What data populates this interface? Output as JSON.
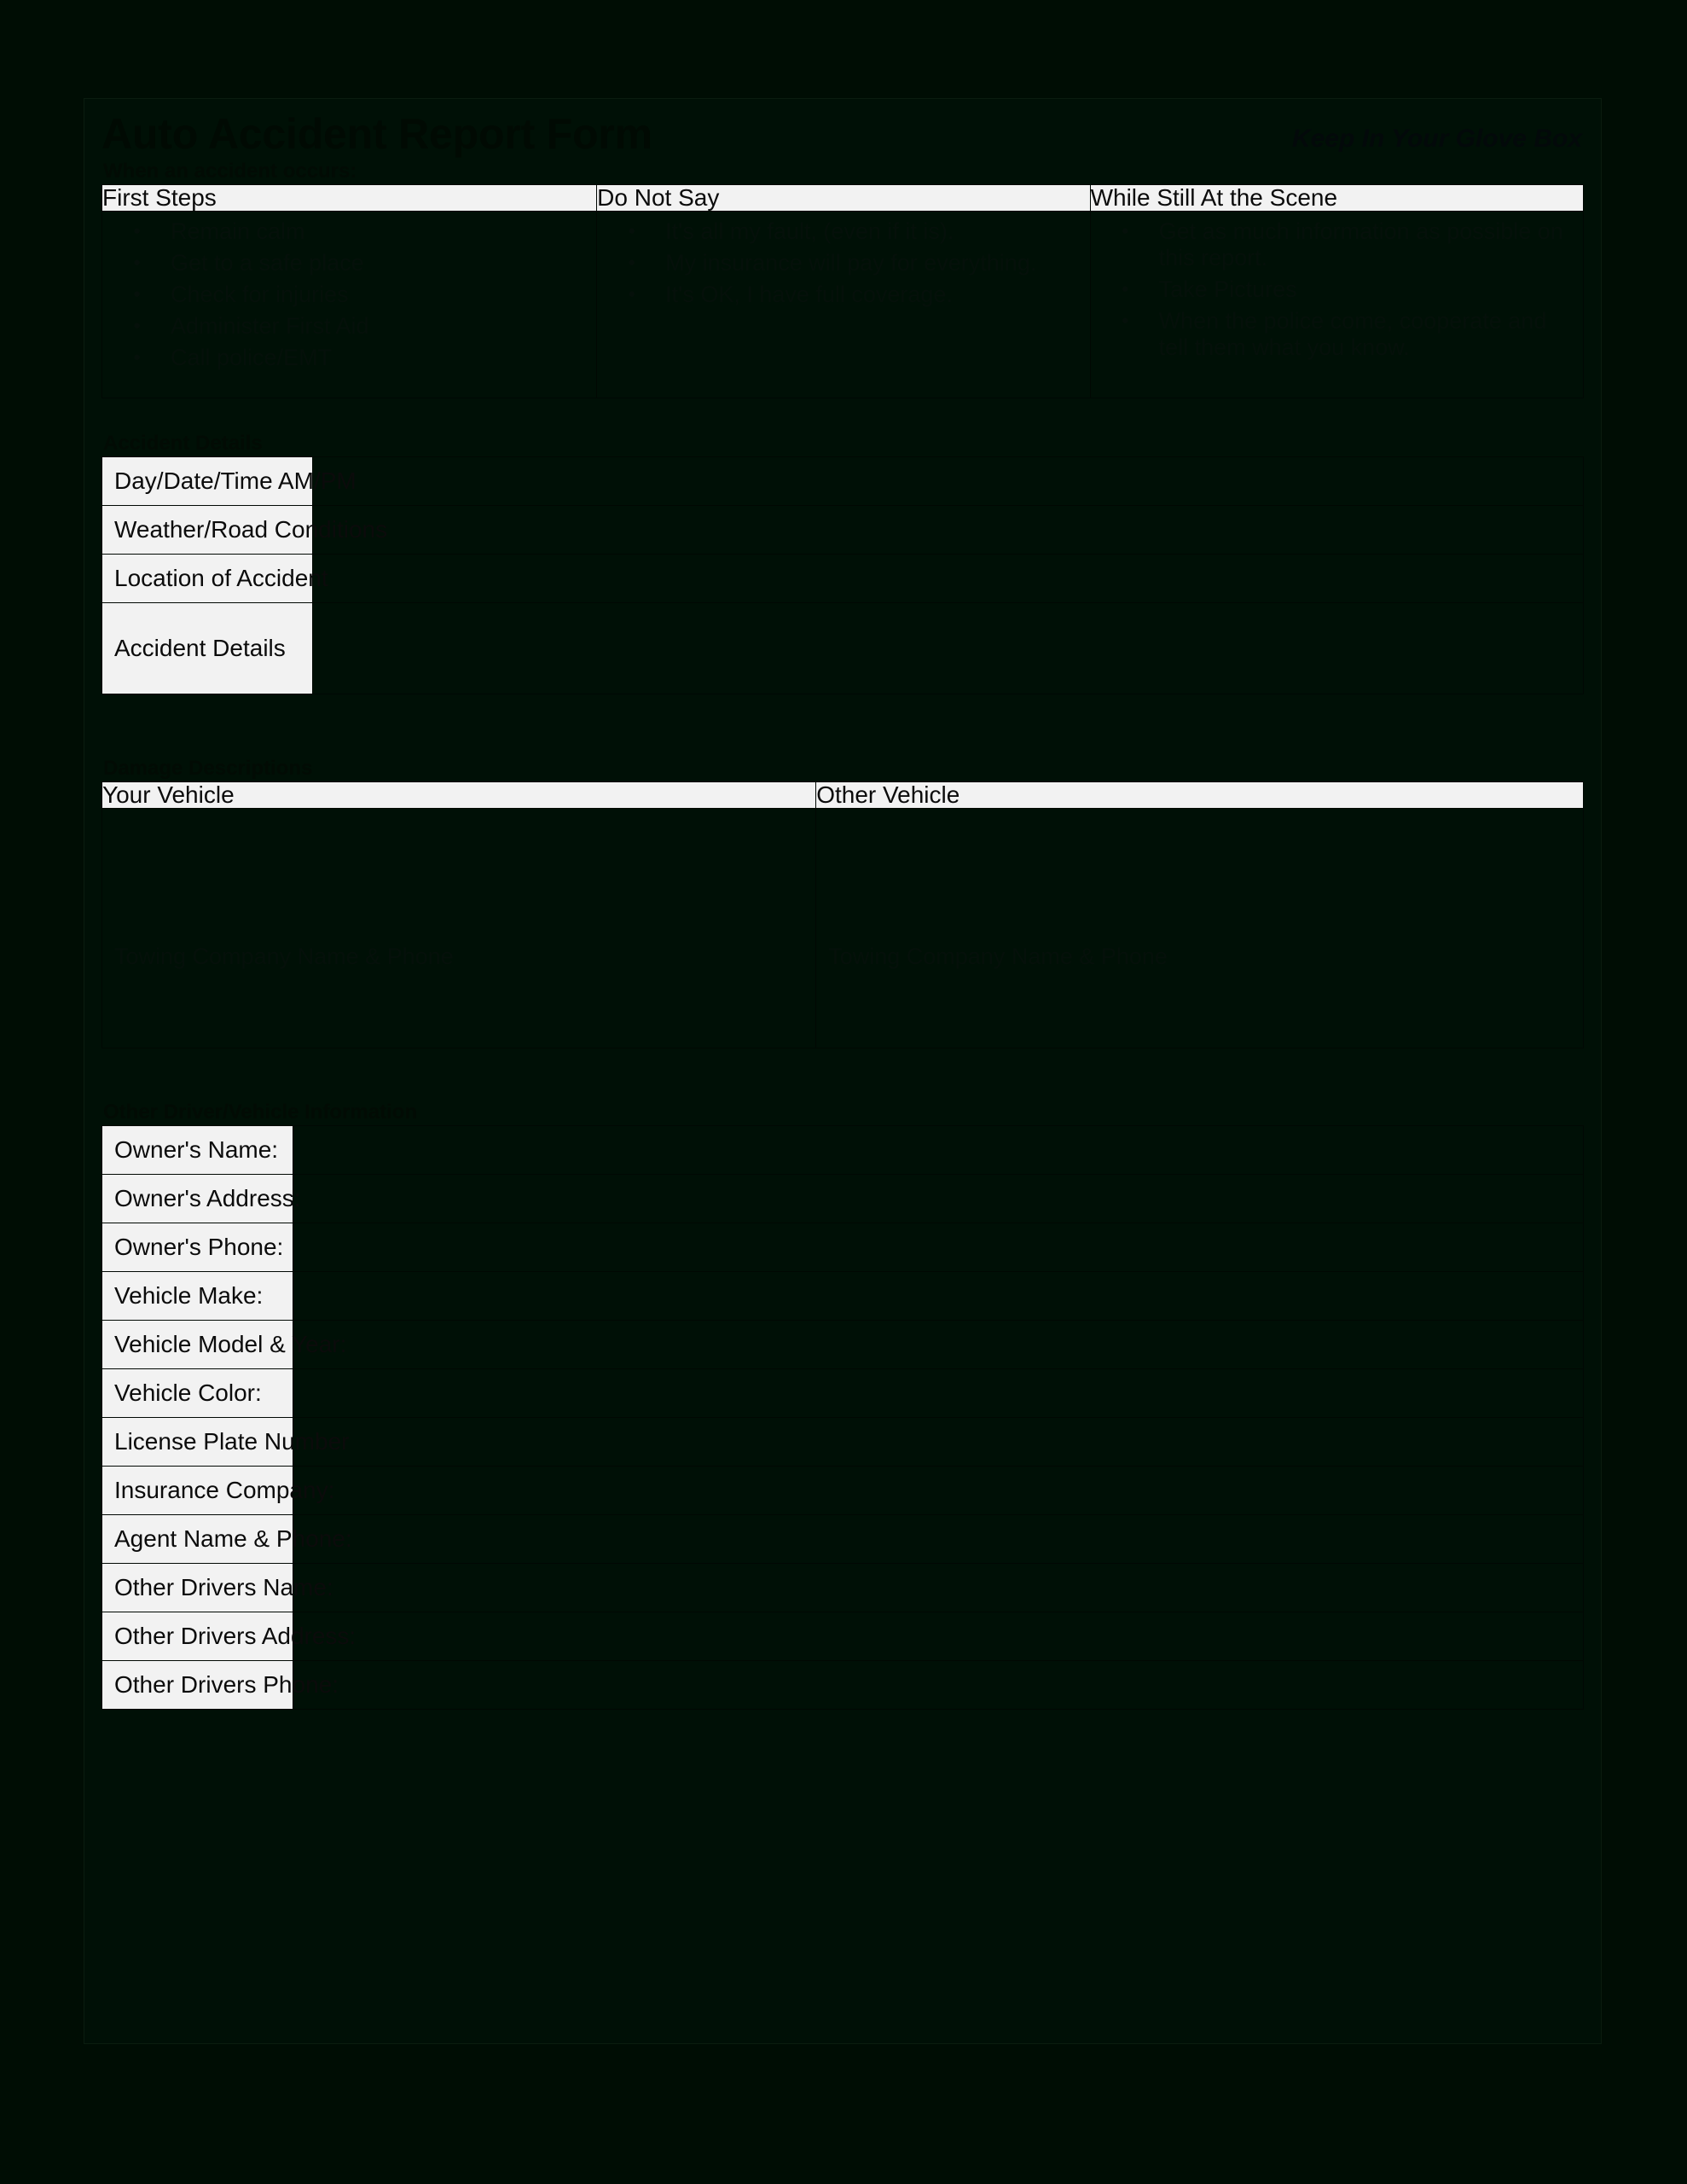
{
  "document": {
    "title": "Auto Accident Report Form",
    "tagline": "Keep In Your Glove Box"
  },
  "when_accident_occurs": {
    "section_label": "When an accident occurs:",
    "columns": [
      {
        "header": "First Steps",
        "items": [
          "Remain calm",
          "Get to a safe place",
          "Check for injuries",
          "Administer First Aid",
          "Call police/EMT"
        ]
      },
      {
        "header": "Do Not Say",
        "items": [
          "It's all my fault, (even if it is).",
          "My insurance will pay for everything.",
          "It's OK, I have full coverage."
        ]
      },
      {
        "header": "While Still At the Scene",
        "items": [
          "Get as much information as possible on this report.",
          "Take Pictures",
          "When the police come, cooperate and tell them what you know."
        ]
      }
    ]
  },
  "accident_details": {
    "section_label": "Accident Details",
    "rows": [
      {
        "label": "Day/Date/Time AM/PM",
        "value": ""
      },
      {
        "label": "Weather/Road Conditions",
        "value": ""
      },
      {
        "label": "Location of Accident",
        "value": ""
      },
      {
        "label": "Accident Details",
        "value": ""
      }
    ]
  },
  "damage_descriptions": {
    "section_label": "Damage Descriptions",
    "columns": [
      {
        "header": "Your Vehicle",
        "towing_label": "Towing Company Name & Phone",
        "value": ""
      },
      {
        "header": "Other Vehicle",
        "towing_label": "Towing Company Name & Phone",
        "value": ""
      }
    ]
  },
  "other_driver_vehicle": {
    "section_label": "Other Driver/Vehicle Information",
    "rows": [
      {
        "label": "Owner's Name:",
        "value": ""
      },
      {
        "label": "Owner's Address:",
        "value": ""
      },
      {
        "label": "Owner's Phone:",
        "value": ""
      },
      {
        "label": "Vehicle Make:",
        "value": ""
      },
      {
        "label": "Vehicle Model & Year:",
        "value": ""
      },
      {
        "label": "Vehicle Color:",
        "value": ""
      },
      {
        "label": "License Plate Number",
        "value": ""
      },
      {
        "label": "Insurance Company:",
        "value": ""
      },
      {
        "label": "Agent Name & Phone:",
        "value": ""
      },
      {
        "label": "Other Drivers Name:",
        "value": ""
      },
      {
        "label": "Other Drivers Address:",
        "value": ""
      },
      {
        "label": "Other Drivers Phone:",
        "value": ""
      }
    ]
  },
  "colors": {
    "page_background": "#001006",
    "canvas_background": "#000d04",
    "header_cell_background": "#f2f2f2",
    "header_cell_text": "#0b0b0b",
    "body_text": "#05100a",
    "border": "#010803"
  }
}
